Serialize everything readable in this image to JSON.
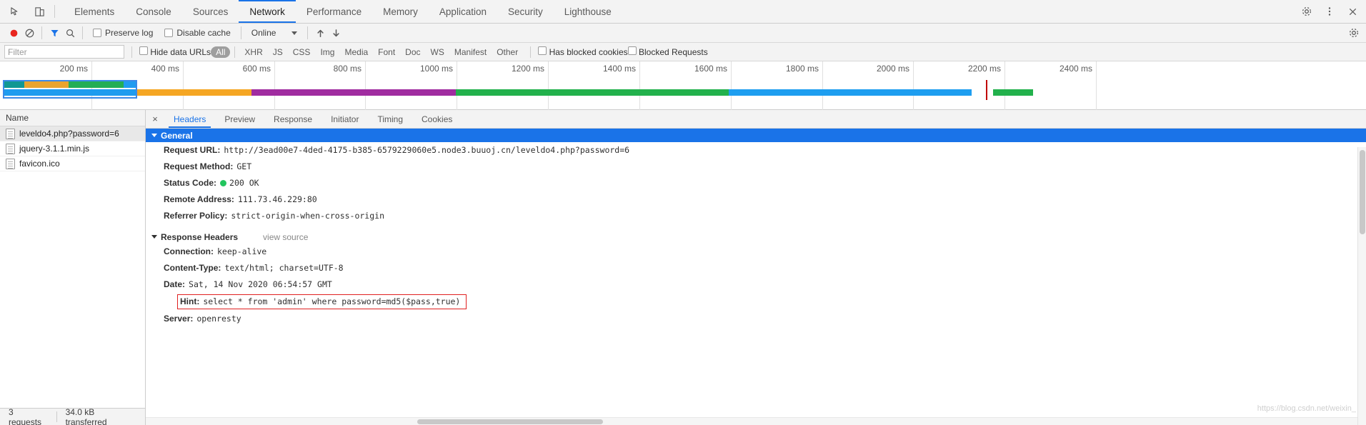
{
  "window": {
    "tabs": [
      {
        "label": "Elements",
        "active": false
      },
      {
        "label": "Console",
        "active": false
      },
      {
        "label": "Sources",
        "active": false
      },
      {
        "label": "Network",
        "active": true
      },
      {
        "label": "Performance",
        "active": false
      },
      {
        "label": "Memory",
        "active": false
      },
      {
        "label": "Application",
        "active": false
      },
      {
        "label": "Security",
        "active": false
      },
      {
        "label": "Lighthouse",
        "active": false
      }
    ],
    "left_icons": [
      "inspect-element-icon",
      "device-toolbar-icon"
    ],
    "right_icons": [
      "settings-gear-icon",
      "more-options-icon",
      "close-icon"
    ]
  },
  "network_toolbar": {
    "record_label": "record-button",
    "clear_label": "clear-button",
    "filter_icon": "filter-funnel-icon",
    "search_icon": "search-icon",
    "preserve_log": "Preserve log",
    "disable_cache": "Disable cache",
    "throttle_value": "Online",
    "import_icon": "import-har-icon",
    "export_icon": "export-har-icon",
    "settings_icon": "network-settings-gear-icon"
  },
  "filter_bar": {
    "filter_placeholder": "Filter",
    "filter_value": "",
    "hide_data_urls": "Hide data URLs",
    "types": [
      {
        "label": "All",
        "active": true
      },
      {
        "label": "XHR",
        "active": false
      },
      {
        "label": "JS",
        "active": false
      },
      {
        "label": "CSS",
        "active": false
      },
      {
        "label": "Img",
        "active": false
      },
      {
        "label": "Media",
        "active": false
      },
      {
        "label": "Font",
        "active": false
      },
      {
        "label": "Doc",
        "active": false
      },
      {
        "label": "WS",
        "active": false
      },
      {
        "label": "Manifest",
        "active": false
      },
      {
        "label": "Other",
        "active": false
      }
    ],
    "has_blocked_cookies": "Has blocked cookies",
    "blocked_requests": "Blocked Requests"
  },
  "overview": {
    "ticks": [
      "200 ms",
      "400 ms",
      "600 ms",
      "800 ms",
      "1000 ms",
      "1200 ms",
      "1400 ms",
      "1600 ms",
      "1800 ms",
      "2000 ms",
      "2200 ms",
      "2400 ms"
    ],
    "colors": {
      "teal": "#0f9a8e",
      "orange": "#f5a623",
      "green": "#22b14c",
      "blue": "#1e9ef0",
      "purple": "#a02ca0",
      "selection_border": "#3b8ae8",
      "dom_content_loaded": "#1e9ef0",
      "load_event": "#c00000"
    }
  },
  "request_list": {
    "column_header": "Name",
    "rows": [
      {
        "name": "leveldo4.php?password=6",
        "selected": true
      },
      {
        "name": "jquery-3.1.1.min.js",
        "selected": false
      },
      {
        "name": "favicon.ico",
        "selected": false
      }
    ],
    "footer": {
      "requests": "3 requests",
      "transferred": "34.0 kB transferred"
    }
  },
  "details": {
    "close_label": "×",
    "tabs": [
      {
        "label": "Headers",
        "active": true
      },
      {
        "label": "Preview",
        "active": false
      },
      {
        "label": "Response",
        "active": false
      },
      {
        "label": "Initiator",
        "active": false
      },
      {
        "label": "Timing",
        "active": false
      },
      {
        "label": "Cookies",
        "active": false
      }
    ],
    "general": {
      "title": "General",
      "rows": [
        {
          "name": "Request URL:",
          "value": "http://3ead00e7-4ded-4175-b385-6579229060e5.node3.buuoj.cn/leveldo4.php?password=6"
        },
        {
          "name": "Request Method:",
          "value": "GET"
        },
        {
          "name": "Status Code:",
          "value": "200 OK",
          "status_dot": true
        },
        {
          "name": "Remote Address:",
          "value": "111.73.46.229:80"
        },
        {
          "name": "Referrer Policy:",
          "value": "strict-origin-when-cross-origin"
        }
      ]
    },
    "response_headers": {
      "title": "Response Headers",
      "view_source": "view source",
      "rows": [
        {
          "name": "Connection:",
          "value": "keep-alive",
          "highlighted": false
        },
        {
          "name": "Content-Type:",
          "value": "text/html; charset=UTF-8",
          "highlighted": false
        },
        {
          "name": "Date:",
          "value": "Sat, 14 Nov 2020 06:54:57 GMT",
          "highlighted": false
        },
        {
          "name": "Hint:",
          "value": "select * from 'admin' where password=md5($pass,true)",
          "highlighted": true
        },
        {
          "name": "Server:",
          "value": "openresty",
          "highlighted": false
        }
      ]
    }
  },
  "watermark": "https://blog.csdn.net/weixin_"
}
